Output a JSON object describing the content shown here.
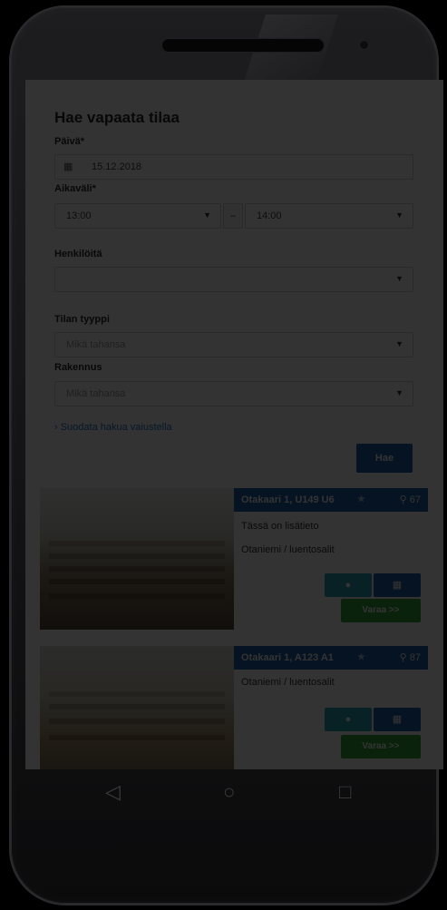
{
  "form": {
    "title": "Hae vapaata tilaa",
    "date_label": "Päivä*",
    "date_value": "15.12.2018",
    "time_label": "Aikaväli*",
    "time_start": "13:00",
    "time_end": "14:00",
    "dash": "–",
    "persons_label": "Henkilöitä",
    "persons_value": "",
    "room_type_label": "Tilan tyyppi",
    "room_type_value": "Mikä tahansa",
    "building_label": "Rakennus",
    "building_value": "Mikä tahansa",
    "advanced_link": "› Suodata hakua vaiustella",
    "search_button": "Hae"
  },
  "results": [
    {
      "name": "Otakaari 1, U149 U6",
      "capacity": "67",
      "info": "Tässä on lisätieto",
      "category": "Otaniemi / luentosalit",
      "book_button": "Varaa >>"
    },
    {
      "name": "Otakaari 1, A123 A1",
      "capacity": "87",
      "info": "",
      "category": "Otaniemi / luentosalit",
      "book_button": "Varaa >>"
    }
  ],
  "icons": {
    "calendar": "calendar-icon",
    "star": "star-icon",
    "person": "person-icon",
    "info": "info-icon",
    "back": "back-icon",
    "home": "home-icon",
    "recents": "recents-icon"
  },
  "colors": {
    "primary": "#1f5fa8",
    "teal": "#2aa3b8",
    "green": "#35a83a",
    "link": "#2874c7"
  }
}
